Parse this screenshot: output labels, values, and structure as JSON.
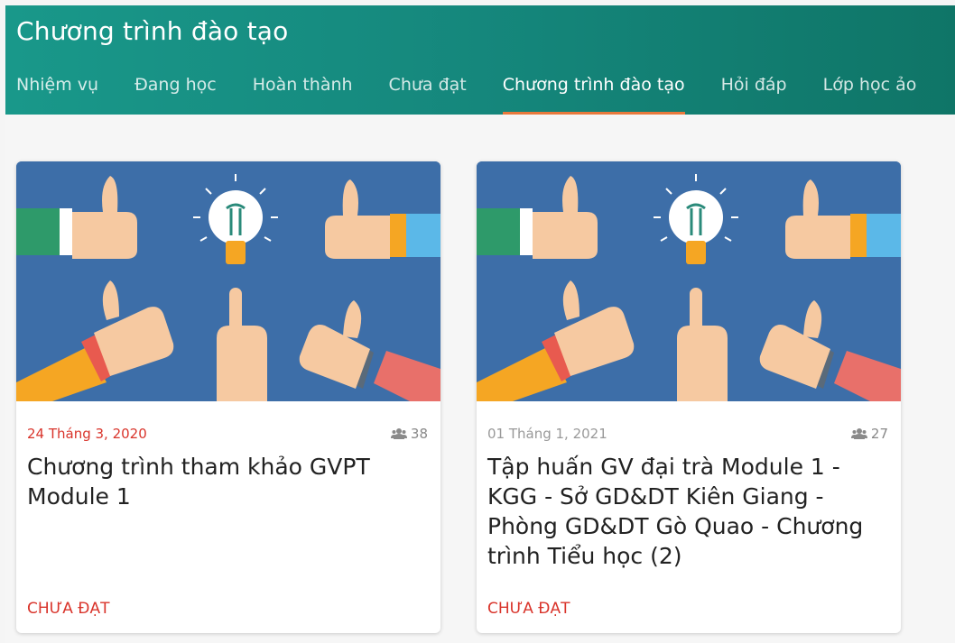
{
  "header": {
    "title": "Chương trình đào tạo",
    "tabs": [
      {
        "label": "Nhiệm vụ",
        "active": false
      },
      {
        "label": "Đang học",
        "active": false
      },
      {
        "label": "Hoàn thành",
        "active": false
      },
      {
        "label": "Chưa đạt",
        "active": false
      },
      {
        "label": "Chương trình đào tạo",
        "active": true
      },
      {
        "label": "Hỏi đáp",
        "active": false
      },
      {
        "label": "Lớp học ảo",
        "active": false
      }
    ]
  },
  "courses": [
    {
      "date": "24 Tháng 3, 2020",
      "participants": "38",
      "title": "Chương trình tham khảo GVPT Module 1",
      "status": "CHƯA ĐẠT",
      "thumbnail_icon": "thumbs-up-lightbulb-illustration"
    },
    {
      "date": "01 Tháng 1, 2021",
      "participants": "27",
      "title": "Tập huấn GV đại trà Module 1 - KGG - Sở GD&DT Kiên Giang - Phòng GD&DT Gò Quao - Chương trình Tiểu học (2)",
      "status": "CHƯA ĐẠT",
      "thumbnail_icon": "thumbs-up-lightbulb-illustration"
    }
  ],
  "colors": {
    "header_bg": "#15877c",
    "tab_indicator": "#e8793c",
    "status_red": "#d9342b",
    "thumb_bg": "#3d6ea8"
  }
}
